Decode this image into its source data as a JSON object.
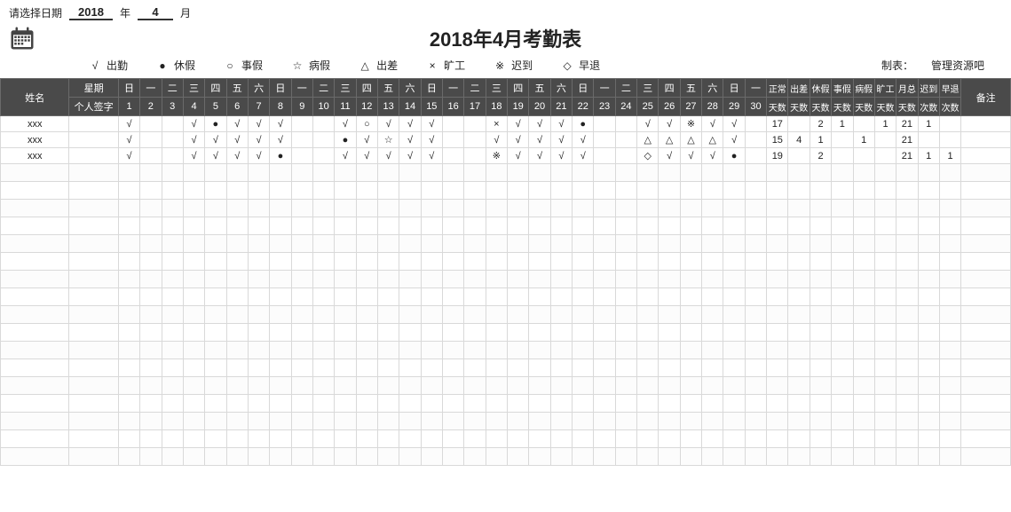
{
  "topbar": {
    "selectLabel": "请选择日期",
    "year": "2018",
    "yearUnit": "年",
    "month": "4",
    "monthUnit": "月"
  },
  "title": "2018年4月考勤表",
  "legend": [
    {
      "sym": "√",
      "label": "出勤"
    },
    {
      "sym": "●",
      "label": "休假"
    },
    {
      "sym": "○",
      "label": "事假"
    },
    {
      "sym": "☆",
      "label": "病假"
    },
    {
      "sym": "△",
      "label": "出差"
    },
    {
      "sym": "×",
      "label": "旷工"
    },
    {
      "sym": "※",
      "label": "迟到"
    },
    {
      "sym": "◇",
      "label": "早退"
    }
  ],
  "maker": {
    "label": "制表：",
    "value": "管理资源吧"
  },
  "headers": {
    "name": "姓名",
    "weekRow": "星期",
    "signRow": "个人签字",
    "weekdays": [
      "日",
      "一",
      "二",
      "三",
      "四",
      "五",
      "六",
      "日",
      "一",
      "二",
      "三",
      "四",
      "五",
      "六",
      "日",
      "一",
      "二",
      "三",
      "四",
      "五",
      "六",
      "日",
      "一",
      "二",
      "三",
      "四",
      "五",
      "六",
      "日",
      "一"
    ],
    "days": [
      "1",
      "2",
      "3",
      "4",
      "5",
      "6",
      "7",
      "8",
      "9",
      "10",
      "11",
      "12",
      "13",
      "14",
      "15",
      "16",
      "17",
      "18",
      "19",
      "20",
      "21",
      "22",
      "23",
      "24",
      "25",
      "26",
      "27",
      "28",
      "29",
      "30"
    ],
    "sumTop": [
      "正常",
      "出差",
      "休假",
      "事假",
      "病假",
      "旷工",
      "月总",
      "迟到",
      "早退"
    ],
    "sumBottom": [
      "天数",
      "天数",
      "天数",
      "天数",
      "天数",
      "天数",
      "天数",
      "次数",
      "次数"
    ],
    "note": "备注"
  },
  "rows": [
    {
      "name": "xxx",
      "marks": [
        "√",
        "",
        "",
        "√",
        "●",
        "√",
        "√",
        "√",
        "",
        "",
        "√",
        "○",
        "√",
        "√",
        "√",
        "",
        "",
        "×",
        "√",
        "√",
        "√",
        "●",
        "",
        "",
        "√",
        "√",
        "※",
        "√",
        "√",
        ""
      ],
      "sums": [
        "17",
        "",
        "2",
        "1",
        "",
        "1",
        "21",
        "1",
        ""
      ],
      "note": ""
    },
    {
      "name": "xxx",
      "marks": [
        "√",
        "",
        "",
        "√",
        "√",
        "√",
        "√",
        "√",
        "",
        "",
        "●",
        "√",
        "☆",
        "√",
        "√",
        "",
        "",
        "√",
        "√",
        "√",
        "√",
        "√",
        "",
        "",
        "△",
        "△",
        "△",
        "△",
        "√",
        ""
      ],
      "sums": [
        "15",
        "4",
        "1",
        "",
        "1",
        "",
        "21",
        "",
        ""
      ],
      "note": ""
    },
    {
      "name": "xxx",
      "marks": [
        "√",
        "",
        "",
        "√",
        "√",
        "√",
        "√",
        "●",
        "",
        "",
        "√",
        "√",
        "√",
        "√",
        "√",
        "",
        "",
        "※",
        "√",
        "√",
        "√",
        "√",
        "",
        "",
        "◇",
        "√",
        "√",
        "√",
        "●",
        ""
      ],
      "sums": [
        "19",
        "",
        "2",
        "",
        "",
        "",
        "21",
        "1",
        "1"
      ],
      "note": ""
    }
  ],
  "emptyRows": 17
}
